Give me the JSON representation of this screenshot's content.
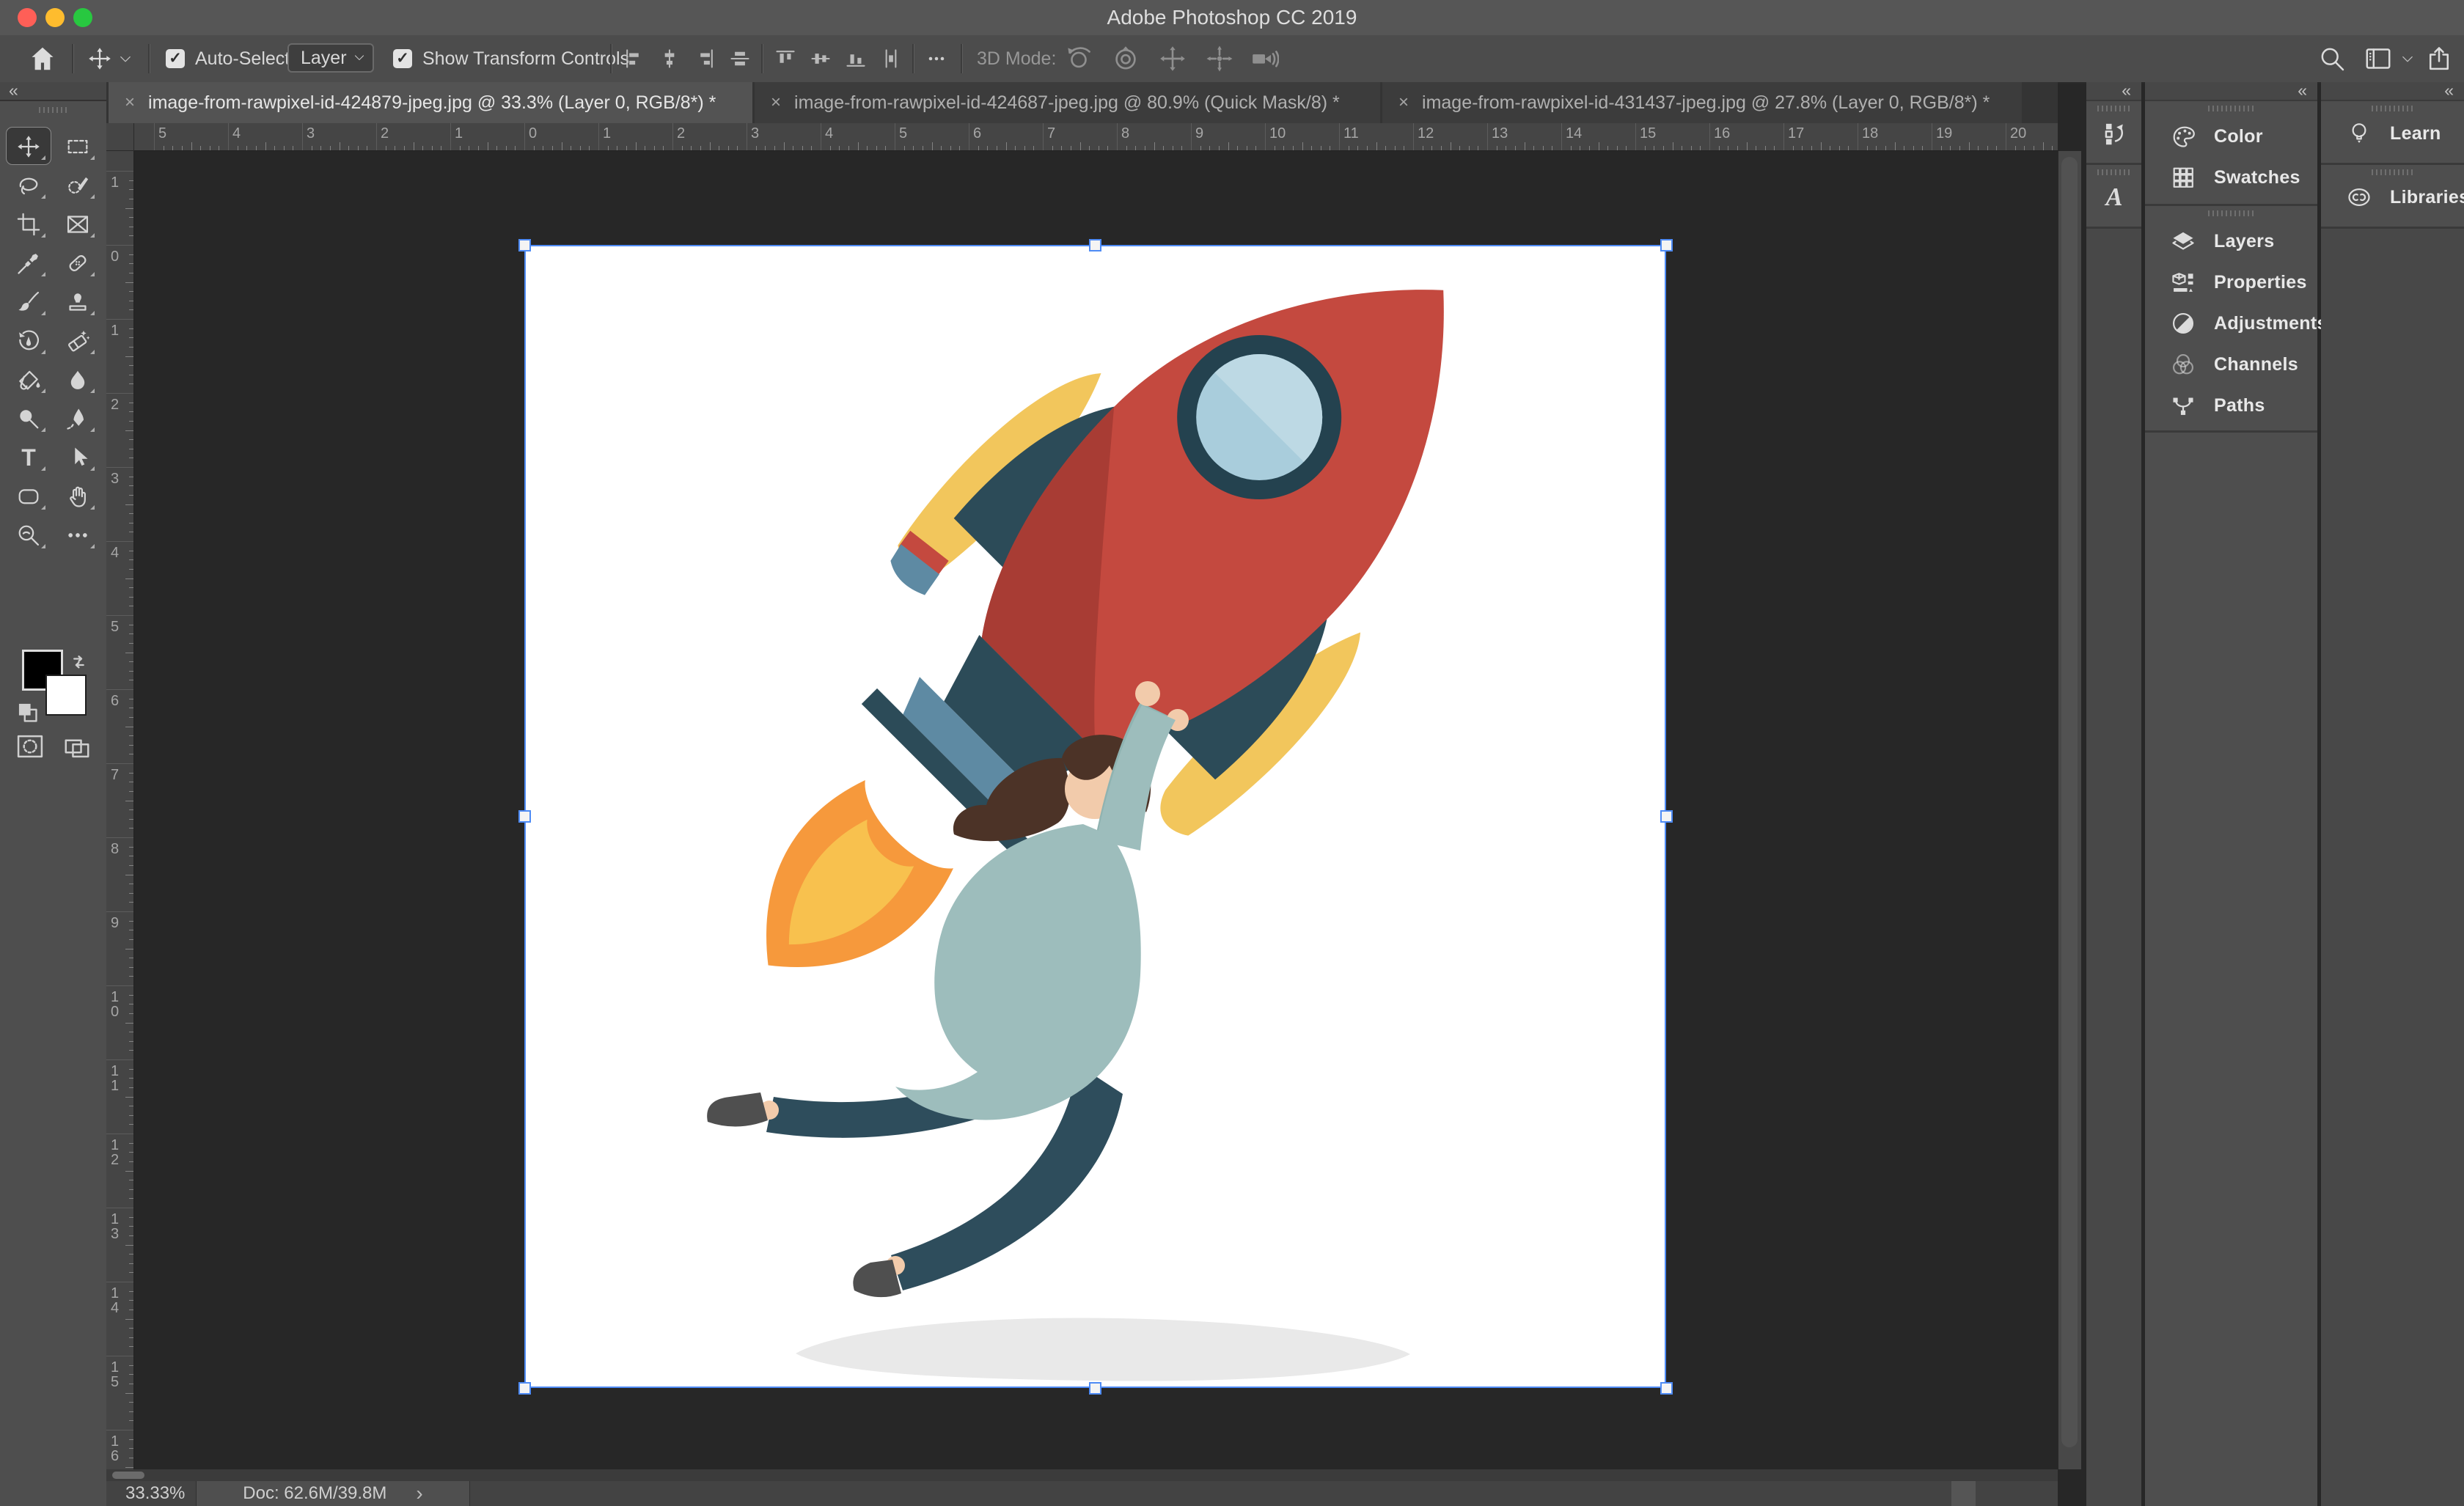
{
  "window": {
    "title": "Adobe Photoshop CC 2019",
    "traffic_lights": {
      "close": "#ff5f57",
      "minimize": "#febc2e",
      "zoom": "#28c840"
    }
  },
  "options_bar": {
    "auto_select": {
      "checked": true,
      "label": "Auto-Select:",
      "value": "Layer"
    },
    "show_transform": {
      "checked": true,
      "label": "Show Transform Controls"
    },
    "mode_3d_label": "3D Mode:",
    "check_glyph": "✓",
    "collapse_glyph": "«"
  },
  "tabs": [
    {
      "close": "×",
      "label": "image-from-rawpixel-id-424879-jpeg.jpg @ 33.3% (Layer 0, RGB/8*) *",
      "active": true
    },
    {
      "close": "×",
      "label": "image-from-rawpixel-id-424687-jpeg.jpg @ 80.9% (Quick Mask/8) *",
      "active": false
    },
    {
      "close": "×",
      "label": "image-from-rawpixel-id-431437-jpeg.jpg @ 27.8% (Layer 0, RGB/8*) *",
      "active": false
    }
  ],
  "toolbar": {
    "selected": "move",
    "tools": [
      [
        "move",
        "rect-marquee"
      ],
      [
        "lasso",
        "quick-select"
      ],
      [
        "crop",
        "frame"
      ],
      [
        "eyedropper",
        "healing"
      ],
      [
        "brush",
        "clone-stamp"
      ],
      [
        "history-brush",
        "eraser"
      ],
      [
        "paint-bucket",
        "blur"
      ],
      [
        "dodge",
        "pen"
      ],
      [
        "type",
        "path-select"
      ],
      [
        "shape",
        "hand"
      ],
      [
        "zoom-tool",
        "edit-toolbar"
      ]
    ],
    "foreground_color": "#000000",
    "background_color": "#ffffff"
  },
  "rulers": {
    "top": [
      "5",
      "4",
      "3",
      "2",
      "1",
      "0",
      "1",
      "2",
      "3",
      "4",
      "5",
      "6",
      "7",
      "8",
      "9",
      "10",
      "11",
      "12",
      "13",
      "14",
      "15",
      "16",
      "17",
      "18",
      "19",
      "20"
    ],
    "left": [
      "1",
      "0",
      "1",
      "2",
      "3",
      "4",
      "5",
      "6",
      "7",
      "8",
      "9",
      "10",
      "11",
      "12",
      "13",
      "14",
      "15",
      "16"
    ]
  },
  "panels": {
    "icon_column": [
      "history",
      "glyphs"
    ],
    "groups": [
      [
        {
          "label": "Color",
          "icon": "color"
        },
        {
          "label": "Swatches",
          "icon": "swatches"
        }
      ],
      [
        {
          "label": "Layers",
          "icon": "layers"
        },
        {
          "label": "Properties",
          "icon": "properties"
        },
        {
          "label": "Adjustments",
          "icon": "adjustments"
        },
        {
          "label": "Channels",
          "icon": "channels"
        },
        {
          "label": "Paths",
          "icon": "paths"
        }
      ]
    ],
    "right_groups": [
      [
        {
          "label": "Learn",
          "icon": "learn"
        }
      ],
      [
        {
          "label": "Libraries",
          "icon": "libraries"
        }
      ]
    ]
  },
  "status_bar": {
    "zoom": "33.33%",
    "doc": "Doc: 62.6M/39.8M",
    "chevron": "›"
  },
  "selection_color": "#4e8bf5",
  "illustration_palette": {
    "rocket_red": "#c4493f",
    "rocket_red_dark": "#a83c34",
    "window_ring": "#24424f",
    "window_glass": "#a9cddc",
    "window_glass_light": "#bdd9e4",
    "fin_teal": "#2c4b58",
    "wing_yellow": "#f2c65c",
    "flame_orange": "#f6993c",
    "flame_yellow": "#f8c14e",
    "nozzle_steel": "#5e8aa3",
    "jacket": "#9dbdbc",
    "jacket_dark": "#8fb3b1",
    "pants": "#2e4d5c",
    "skin": "#f2cbab",
    "hair": "#4c3327",
    "shoes": "#4f4f4f",
    "shadow": "#e9e9e9"
  }
}
